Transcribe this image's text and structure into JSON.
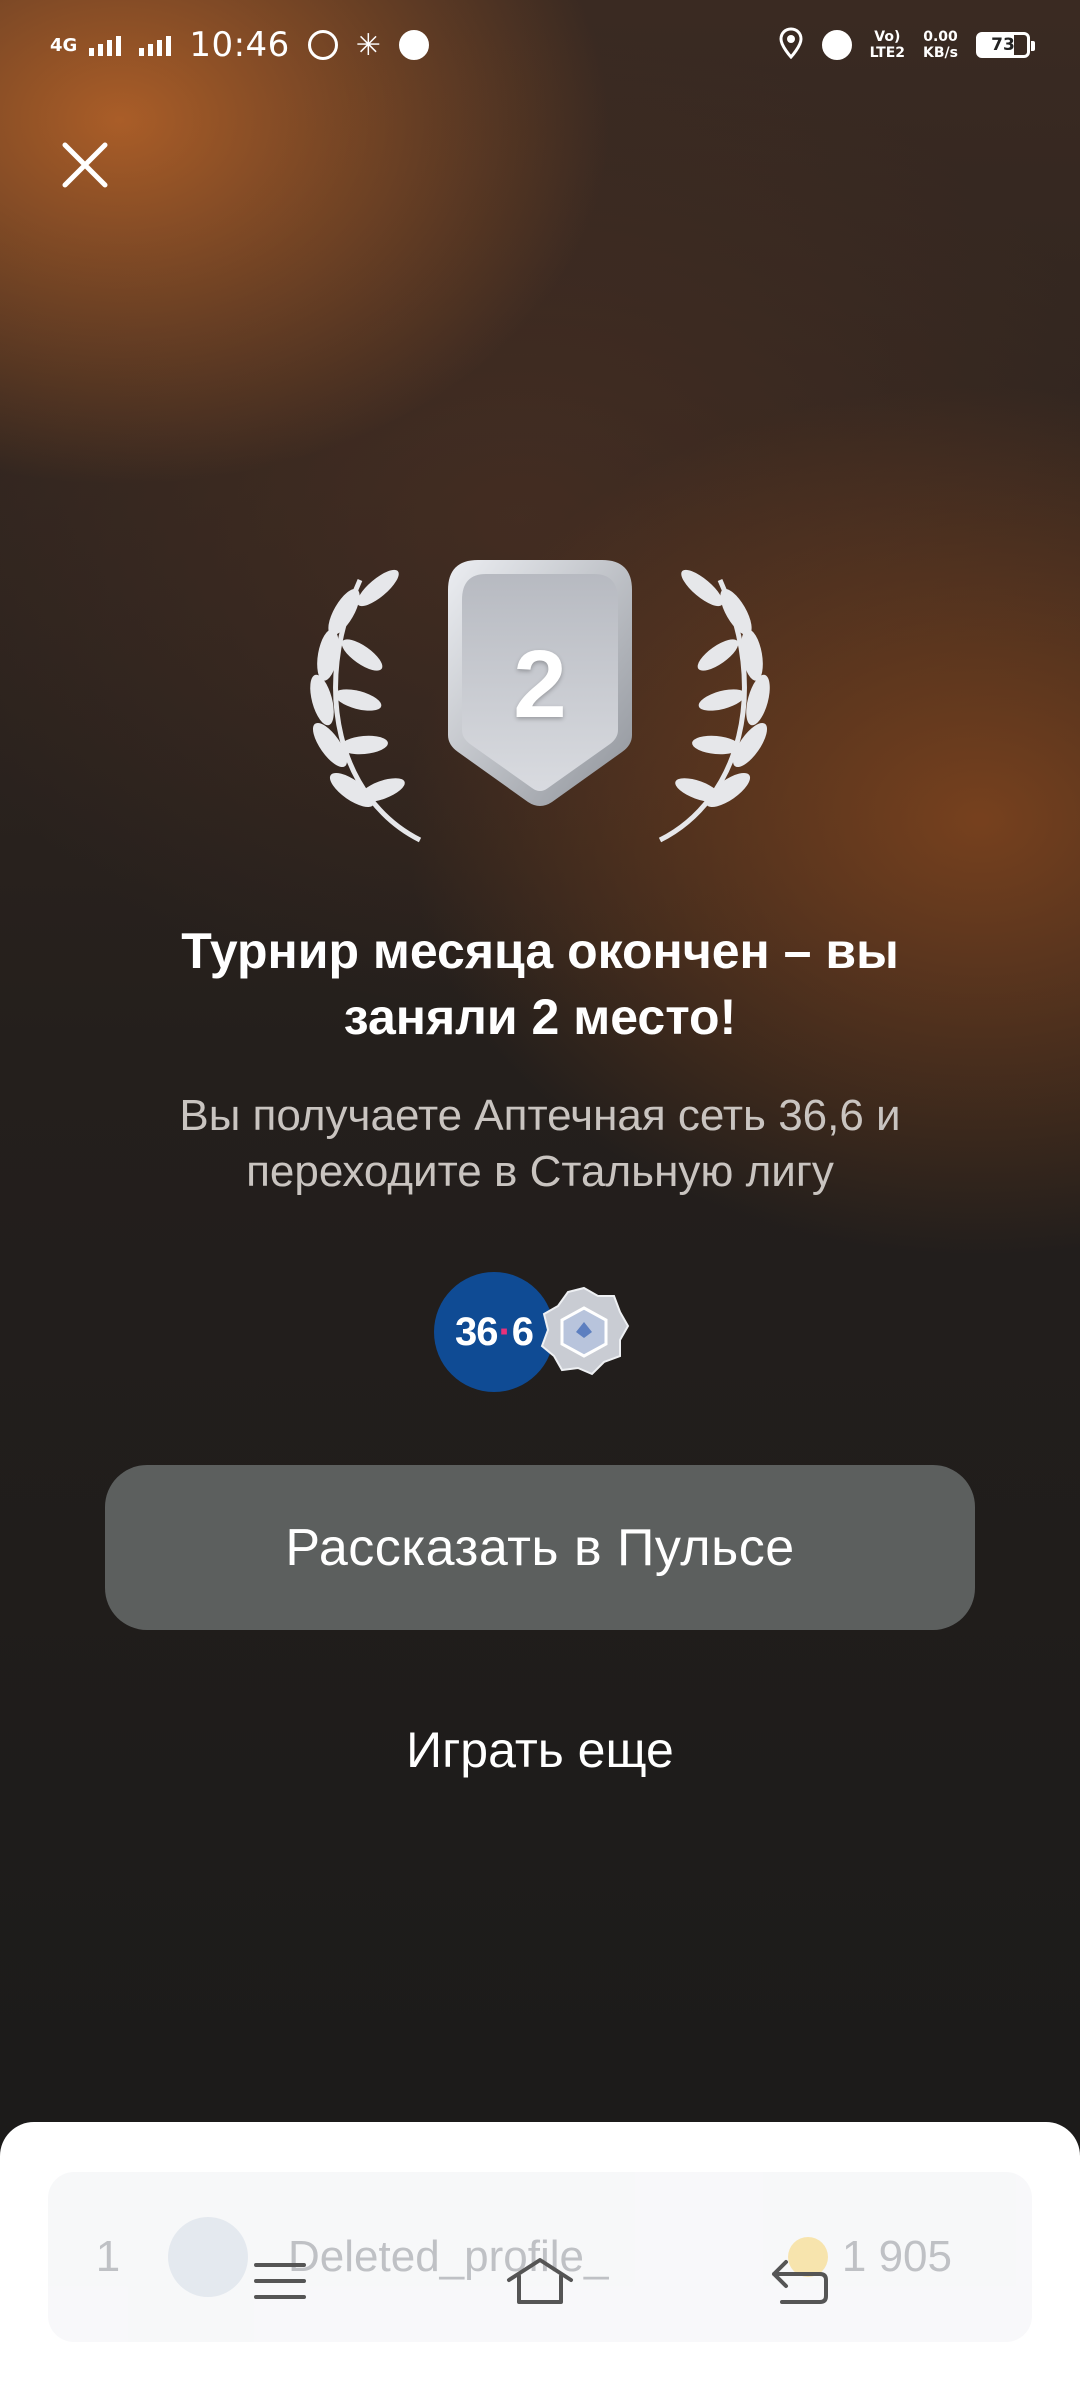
{
  "status_bar": {
    "network": "4G",
    "time": "10:46",
    "volte": "Vo)",
    "lte": "LTE2",
    "speed_value": "0.00",
    "speed_unit": "KB/s",
    "battery": "73"
  },
  "result": {
    "place": "2",
    "title": "Турнир месяца окончен – вы заняли 2 место!",
    "subtitle": "Вы получаете Аптечная сеть 36,6 и переходите в Стальную лигу",
    "partner_logo_left": "36",
    "partner_logo_dot": "·",
    "partner_logo_right": "6"
  },
  "actions": {
    "share": "Рассказать в Пульсе",
    "play_again": "Играть еще"
  },
  "leaderboard": {
    "rank": "1",
    "name": "Deleted_profile_",
    "score": "1 905"
  },
  "icons": {
    "close": "close-icon",
    "menu": "menu-icon",
    "home": "home-icon",
    "back": "back-icon",
    "laurel": "laurel-icon",
    "league": "steel-league-icon"
  },
  "colors": {
    "primary_button": "#5c5f5e",
    "partner_blue": "#0f4b94",
    "partner_pink": "#e8317a",
    "silver": "#c3c6cc"
  }
}
